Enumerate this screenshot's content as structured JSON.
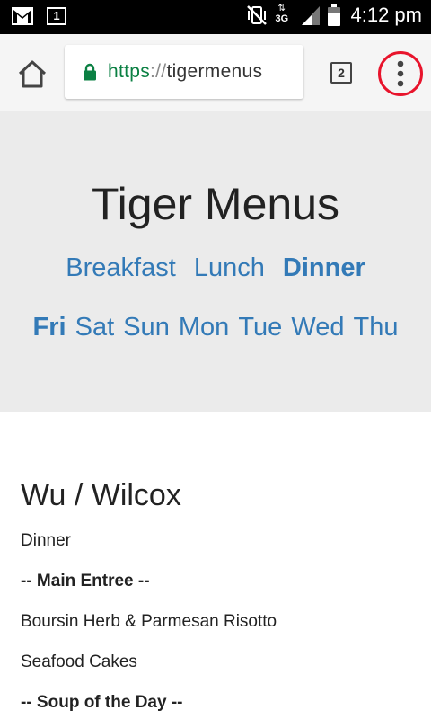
{
  "status_bar": {
    "time": "4:12 pm",
    "sim_badge": "1",
    "network": "3G"
  },
  "browser": {
    "url_scheme": "https",
    "url_separator": "://",
    "url_host": "tigermenus",
    "tab_count": "2"
  },
  "header": {
    "title": "Tiger Menus",
    "meals": [
      {
        "label": "Breakfast",
        "active": false
      },
      {
        "label": "Lunch",
        "active": false
      },
      {
        "label": "Dinner",
        "active": true
      }
    ],
    "days": [
      {
        "label": "Fri",
        "active": true
      },
      {
        "label": "Sat",
        "active": false
      },
      {
        "label": "Sun",
        "active": false
      },
      {
        "label": "Mon",
        "active": false
      },
      {
        "label": "Tue",
        "active": false
      },
      {
        "label": "Wed",
        "active": false
      },
      {
        "label": "Thu",
        "active": false
      }
    ]
  },
  "menu": {
    "hall": "Wu / Wilcox",
    "meal": "Dinner",
    "items": [
      {
        "text": "-- Main Entree --",
        "heading": true
      },
      {
        "text": "Boursin Herb & Parmesan Risotto",
        "heading": false
      },
      {
        "text": "Seafood Cakes",
        "heading": false
      },
      {
        "text": "-- Soup of the Day --",
        "heading": true
      }
    ]
  },
  "colors": {
    "link": "#337ab7",
    "hero_bg": "#ebebeb",
    "secure_green": "#0b8043",
    "highlight_circle": "#e8142c"
  }
}
